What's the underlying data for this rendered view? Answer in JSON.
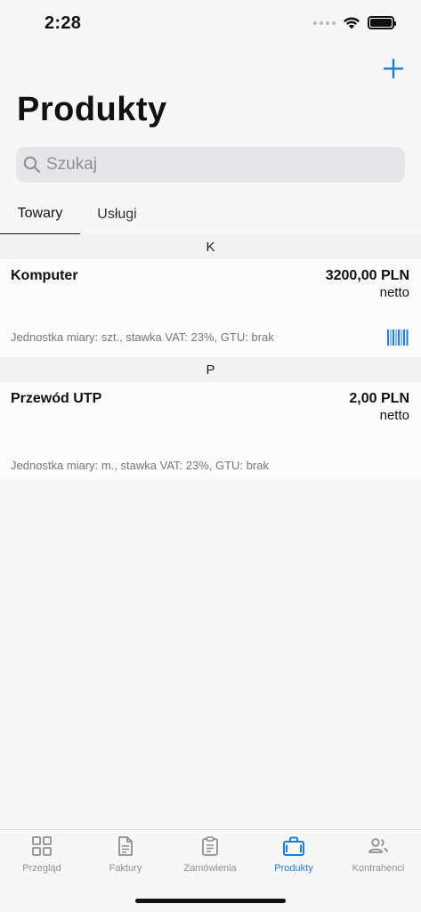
{
  "status_bar": {
    "time": "2:28"
  },
  "header": {
    "title": "Produkty"
  },
  "search": {
    "placeholder": "Szukaj"
  },
  "tabs": [
    {
      "label": "Towary",
      "active": true
    },
    {
      "label": "Usługi",
      "active": false
    }
  ],
  "sections": [
    {
      "letter": "K",
      "products": [
        {
          "name": "Komputer",
          "price": "3200,00 PLN",
          "price_type": "netto",
          "details": "Jednostka miary: szt., stawka VAT: 23%, GTU: brak",
          "has_barcode": true
        }
      ]
    },
    {
      "letter": "P",
      "products": [
        {
          "name": "Przewód UTP",
          "price": "2,00 PLN",
          "price_type": "netto",
          "details": "Jednostka miary: m., stawka VAT: 23%, GTU: brak",
          "has_barcode": false
        }
      ]
    }
  ],
  "bottom_nav": [
    {
      "label": "Przegląd",
      "icon": "grid-icon",
      "active": false
    },
    {
      "label": "Faktury",
      "icon": "document-icon",
      "active": false
    },
    {
      "label": "Zamówienia",
      "icon": "clipboard-icon",
      "active": false
    },
    {
      "label": "Produkty",
      "icon": "briefcase-icon",
      "active": true
    },
    {
      "label": "Kontrahenci",
      "icon": "people-icon",
      "active": false
    }
  ],
  "colors": {
    "accent": "#1a7fd8",
    "inactive": "#8e8e93",
    "background": "#f7f7f7"
  }
}
